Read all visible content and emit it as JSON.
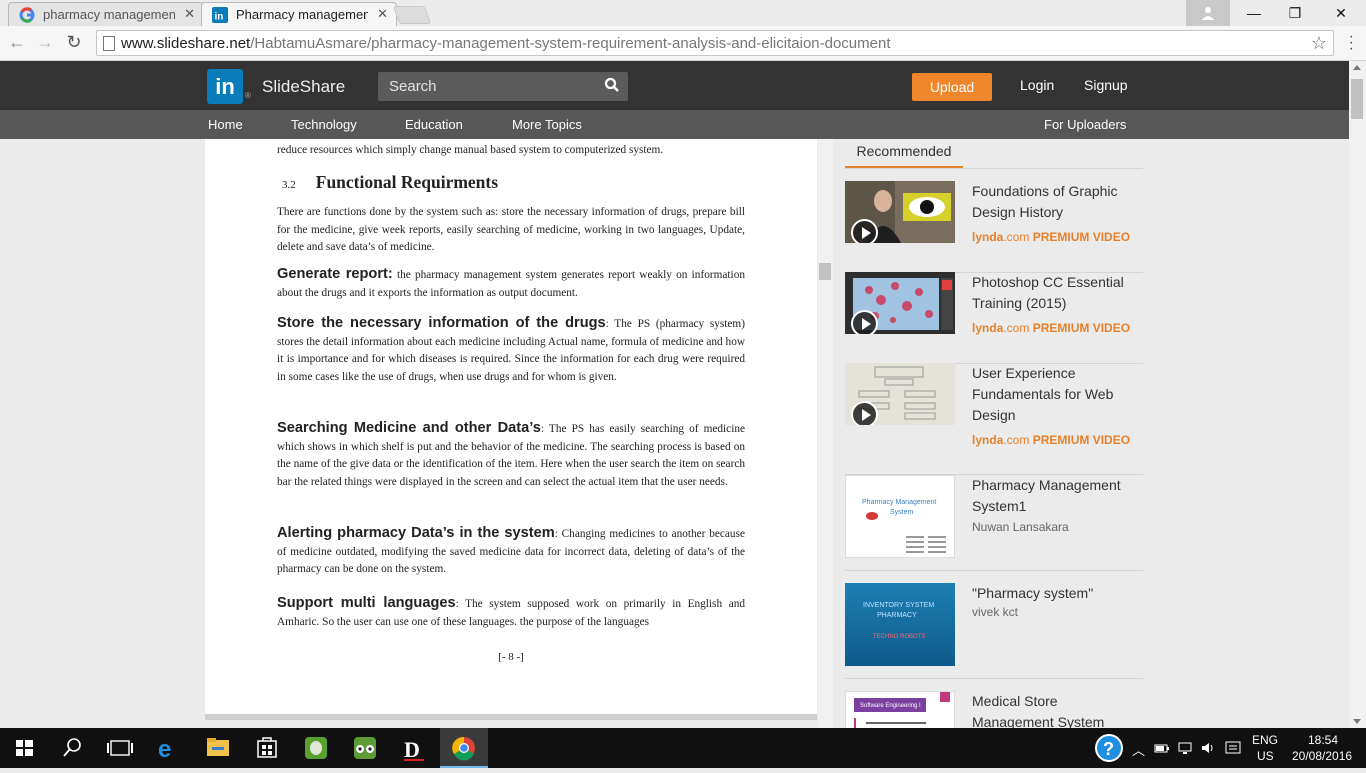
{
  "browser": {
    "tabs": [
      {
        "title": "pharmacy management sy",
        "active": false,
        "icon": "google-icon"
      },
      {
        "title": "Pharmacy management sy",
        "active": true,
        "icon": "linkedin-icon"
      }
    ],
    "url_host": "www.slideshare.net",
    "url_path": "/HabtamuAsmare/pharmacy-management-system-requirement-analysis-and-elicitaion-document"
  },
  "header": {
    "logo_text": "in",
    "brand": "SlideShare",
    "search_placeholder": "Search",
    "upload_label": "Upload",
    "login_label": "Login",
    "signup_label": "Signup",
    "accent_color": "#f0862b"
  },
  "subnav": {
    "home": "Home",
    "technology": "Technology",
    "education": "Education",
    "more_topics": "More Topics",
    "for_uploaders": "For Uploaders"
  },
  "document": {
    "top_line": "reduce resources which simply change manual based system to computerized system.",
    "section_num": "3.2",
    "section_title": "Functional Requirments",
    "intro": "There are functions done by the system such as: store the necessary information of drugs, prepare bill for the medicine, give week reports, easily searching of medicine, working in two languages, Update, delete and save data’s of medicine.",
    "items": [
      {
        "lead": "Generate report:",
        "text": " the pharmacy management system generates report weakly on information about the drugs and it exports the information as output document."
      },
      {
        "lead": "Store the necessary information of the drugs",
        "text": ": The PS (pharmacy system) stores the detail information about each medicine including Actual name, formula of medicine and how it is importance and for which diseases is required. Since the information for each drug were required in some cases like the use of drugs, when use drugs and for whom is given."
      },
      {
        "lead": "Searching Medicine and other Data’s",
        "text": ": The PS has easily searching of medicine which shows in which shelf is put and the behavior of the medicine. The searching process is based on the name of the give data or the identification of the item. Here when the user search the item on search bar the related things were displayed in the screen and can select the actual item that the user needs."
      },
      {
        "lead": "Alerting pharmacy Data’s in the system",
        "text": ": Changing medicines to another because of medicine outdated, modifying the saved medicine data for incorrect data, deleting of data’s of the pharmacy can be done on the system."
      },
      {
        "lead": "Support multi languages",
        "text": ": The system supposed work on primarily in English and Amharic. So the user can use one of these languages. the purpose of the languages"
      }
    ],
    "page_number": "[- 8 -]"
  },
  "sidebar": {
    "tab_label": "Recommended",
    "items": [
      {
        "title": "Foundations of Graphic Design History",
        "badge_brand": "lynda",
        "badge_dot": ".com",
        "badge_label": "PREMIUM VIDEO",
        "thumb": "video-presenter"
      },
      {
        "title": "Photoshop CC Essential Training (2015)",
        "badge_brand": "lynda",
        "badge_dot": ".com",
        "badge_label": "PREMIUM VIDEO",
        "thumb": "photoshop"
      },
      {
        "title": "User Experience Fundamentals for Web Design",
        "badge_brand": "lynda",
        "badge_dot": ".com",
        "badge_label": "PREMIUM VIDEO",
        "thumb": "wireframe"
      },
      {
        "title": "Pharmacy Management System1",
        "author": "Nuwan Lansakara",
        "thumb": "slide-white"
      },
      {
        "title": "\"Pharmacy system\"",
        "author": "vivek kct",
        "thumb": "slide-blue"
      },
      {
        "title": "Medical Store Management System Software",
        "thumb": "slide-pink"
      }
    ]
  },
  "taskbar": {
    "lang": "ENG",
    "region": "US",
    "time": "18:54",
    "date": "20/08/2016"
  }
}
